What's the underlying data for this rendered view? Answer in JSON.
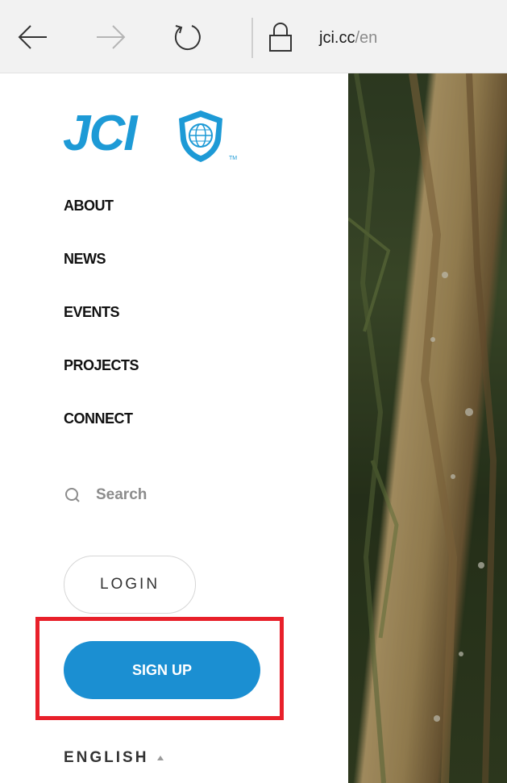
{
  "browser": {
    "address_domain": "jci.cc",
    "address_path": "/en"
  },
  "logo": {
    "text": "JCI",
    "trademark": "TM"
  },
  "nav": {
    "items": [
      {
        "label": "ABOUT"
      },
      {
        "label": "NEWS"
      },
      {
        "label": "EVENTS"
      },
      {
        "label": "PROJECTS"
      },
      {
        "label": "CONNECT"
      }
    ]
  },
  "search": {
    "placeholder": "Search"
  },
  "auth": {
    "login_label": "LOGIN",
    "signup_label": "SIGN UP"
  },
  "language": {
    "selected": "ENGLISH"
  },
  "colors": {
    "brand_blue": "#1d9ad6",
    "signup_blue": "#1b8fd2",
    "highlight_red": "#e8202a"
  }
}
